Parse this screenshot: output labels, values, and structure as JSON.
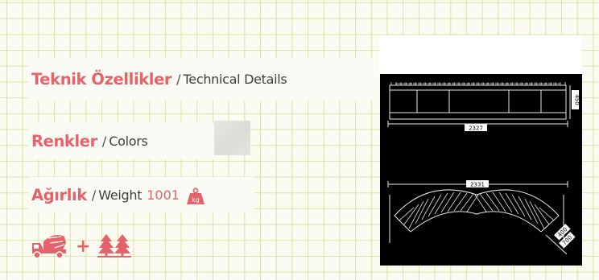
{
  "technical": {
    "title": "Teknik Özellikler",
    "subtitle": "Technical Details"
  },
  "colors": {
    "title": "Renkler",
    "subtitle": "Colors",
    "swatch_color": "#e0e0db"
  },
  "weight": {
    "title": "Ağırlık",
    "subtitle": "Weight",
    "value": "1001",
    "unit": "kg"
  },
  "transport": {
    "truck_icon": "concrete-mixer-truck-icon",
    "plus": "+",
    "trees_icon": "pine-trees-icon"
  },
  "drawing": {
    "top_width": "2327",
    "top_height": "450",
    "bottom_width": "2331",
    "bottom_depth_a": "400",
    "bottom_depth_b": "700"
  },
  "theme": {
    "accent": "#e5626a",
    "grid": "#d4e6a2",
    "background": "#fbfbf2"
  }
}
